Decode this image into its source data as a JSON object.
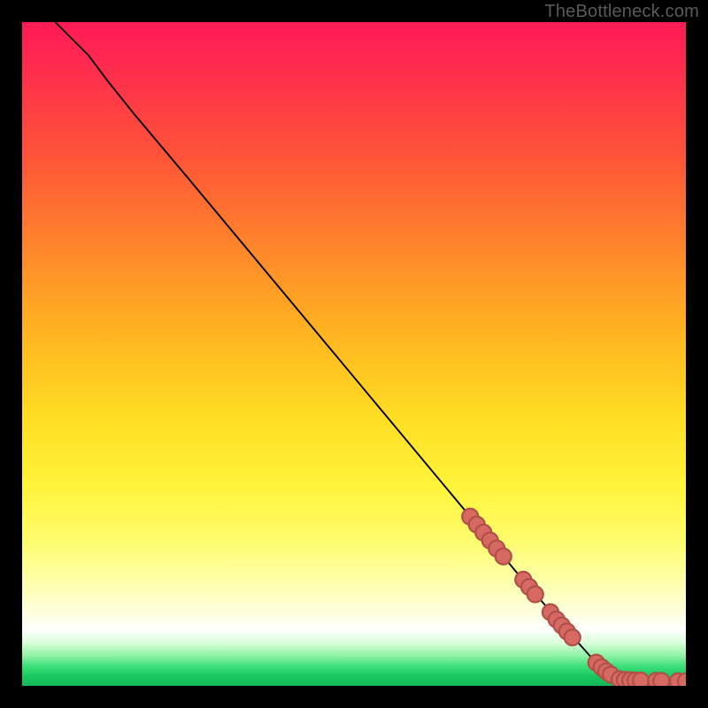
{
  "watermark": "TheBottleneck.com",
  "chart_data": {
    "type": "line",
    "title": "",
    "xlabel": "",
    "ylabel": "",
    "xlim": [
      0,
      100
    ],
    "ylim": [
      0,
      100
    ],
    "curve": {
      "name": "bottleneck-curve",
      "points": [
        {
          "x": 5,
          "y": 100
        },
        {
          "x": 7,
          "y": 98
        },
        {
          "x": 10,
          "y": 95
        },
        {
          "x": 13,
          "y": 91
        },
        {
          "x": 17,
          "y": 86
        },
        {
          "x": 25,
          "y": 76.5
        },
        {
          "x": 35,
          "y": 64.5
        },
        {
          "x": 45,
          "y": 52.5
        },
        {
          "x": 55,
          "y": 40.5
        },
        {
          "x": 65,
          "y": 28.5
        },
        {
          "x": 75,
          "y": 16.5
        },
        {
          "x": 82,
          "y": 8.5
        },
        {
          "x": 86,
          "y": 4
        },
        {
          "x": 88.5,
          "y": 2
        },
        {
          "x": 90,
          "y": 1.2
        },
        {
          "x": 92,
          "y": 0.8
        },
        {
          "x": 95,
          "y": 0.7
        },
        {
          "x": 98,
          "y": 0.7
        },
        {
          "x": 100,
          "y": 0.7
        }
      ]
    },
    "markers": {
      "name": "highlight-points",
      "color": "#d66a63",
      "points": [
        {
          "x": 67.5,
          "y": 25.5,
          "r": 1.2
        },
        {
          "x": 68.5,
          "y": 24.3,
          "r": 1.2
        },
        {
          "x": 69.5,
          "y": 23.1,
          "r": 1.2
        },
        {
          "x": 70.5,
          "y": 21.9,
          "r": 1.2
        },
        {
          "x": 71.5,
          "y": 20.7,
          "r": 1.2
        },
        {
          "x": 72.5,
          "y": 19.5,
          "r": 1.2
        },
        {
          "x": 75.5,
          "y": 16.0,
          "r": 1.2
        },
        {
          "x": 76.4,
          "y": 14.9,
          "r": 1.2
        },
        {
          "x": 77.3,
          "y": 13.8,
          "r": 1.2
        },
        {
          "x": 79.6,
          "y": 11.1,
          "r": 1.2
        },
        {
          "x": 80.5,
          "y": 10.0,
          "r": 1.2
        },
        {
          "x": 81.3,
          "y": 9.1,
          "r": 1.2
        },
        {
          "x": 82.1,
          "y": 8.2,
          "r": 1.2
        },
        {
          "x": 82.9,
          "y": 7.3,
          "r": 1.2
        },
        {
          "x": 86.5,
          "y": 3.5,
          "r": 1.2
        },
        {
          "x": 87.3,
          "y": 2.8,
          "r": 1.2
        },
        {
          "x": 88.0,
          "y": 2.2,
          "r": 1.2
        },
        {
          "x": 88.7,
          "y": 1.7,
          "r": 1.2
        },
        {
          "x": 90.0,
          "y": 1.0,
          "r": 1.2
        },
        {
          "x": 90.8,
          "y": 0.9,
          "r": 1.2
        },
        {
          "x": 91.6,
          "y": 0.85,
          "r": 1.2
        },
        {
          "x": 92.4,
          "y": 0.8,
          "r": 1.2
        },
        {
          "x": 93.2,
          "y": 0.8,
          "r": 1.2
        },
        {
          "x": 95.5,
          "y": 0.75,
          "r": 1.2
        },
        {
          "x": 96.3,
          "y": 0.75,
          "r": 1.2
        },
        {
          "x": 98.8,
          "y": 0.7,
          "r": 1.2
        },
        {
          "x": 100.0,
          "y": 0.7,
          "r": 1.2
        }
      ]
    }
  }
}
